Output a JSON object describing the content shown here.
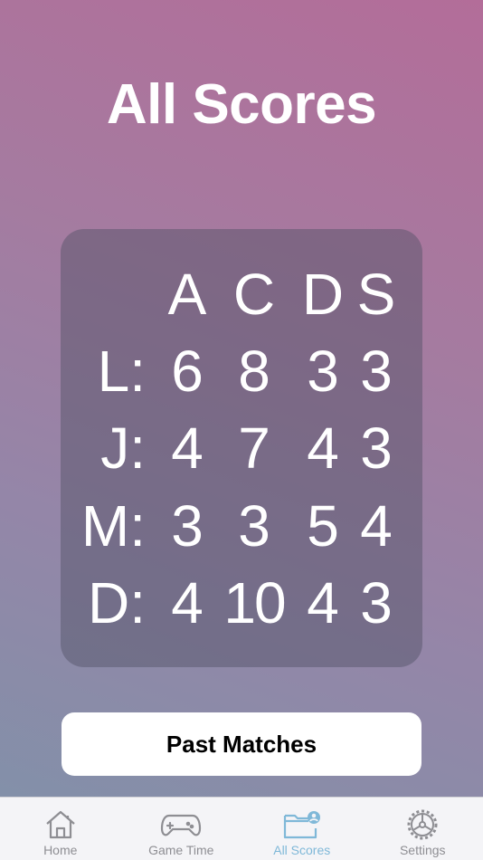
{
  "page": {
    "title": "All Scores"
  },
  "scores": {
    "columns": [
      "A",
      "C",
      "D",
      "S"
    ],
    "rows": [
      {
        "player": "L:",
        "values": [
          "6",
          "8",
          "3",
          "3"
        ]
      },
      {
        "player": "J:",
        "values": [
          "4",
          "7",
          "4",
          "3"
        ]
      },
      {
        "player": "M:",
        "values": [
          "3",
          "3",
          "5",
          "4"
        ]
      },
      {
        "player": "D:",
        "values": [
          "4",
          "10",
          "4",
          "3"
        ]
      }
    ]
  },
  "actions": {
    "past_matches_label": "Past Matches"
  },
  "tab_bar": {
    "items": [
      {
        "label": "Home",
        "icon": "house-icon",
        "active": false
      },
      {
        "label": "Game Time",
        "icon": "gamecontroller-icon",
        "active": false
      },
      {
        "label": "All Scores",
        "icon": "folder-person-icon",
        "active": true
      },
      {
        "label": "Settings",
        "icon": "gear-icon",
        "active": false
      }
    ]
  },
  "colors": {
    "accent": "#7fb8d8",
    "inactive_tab": "#8e8e93",
    "card": "rgba(80,80,100,0.45)"
  }
}
